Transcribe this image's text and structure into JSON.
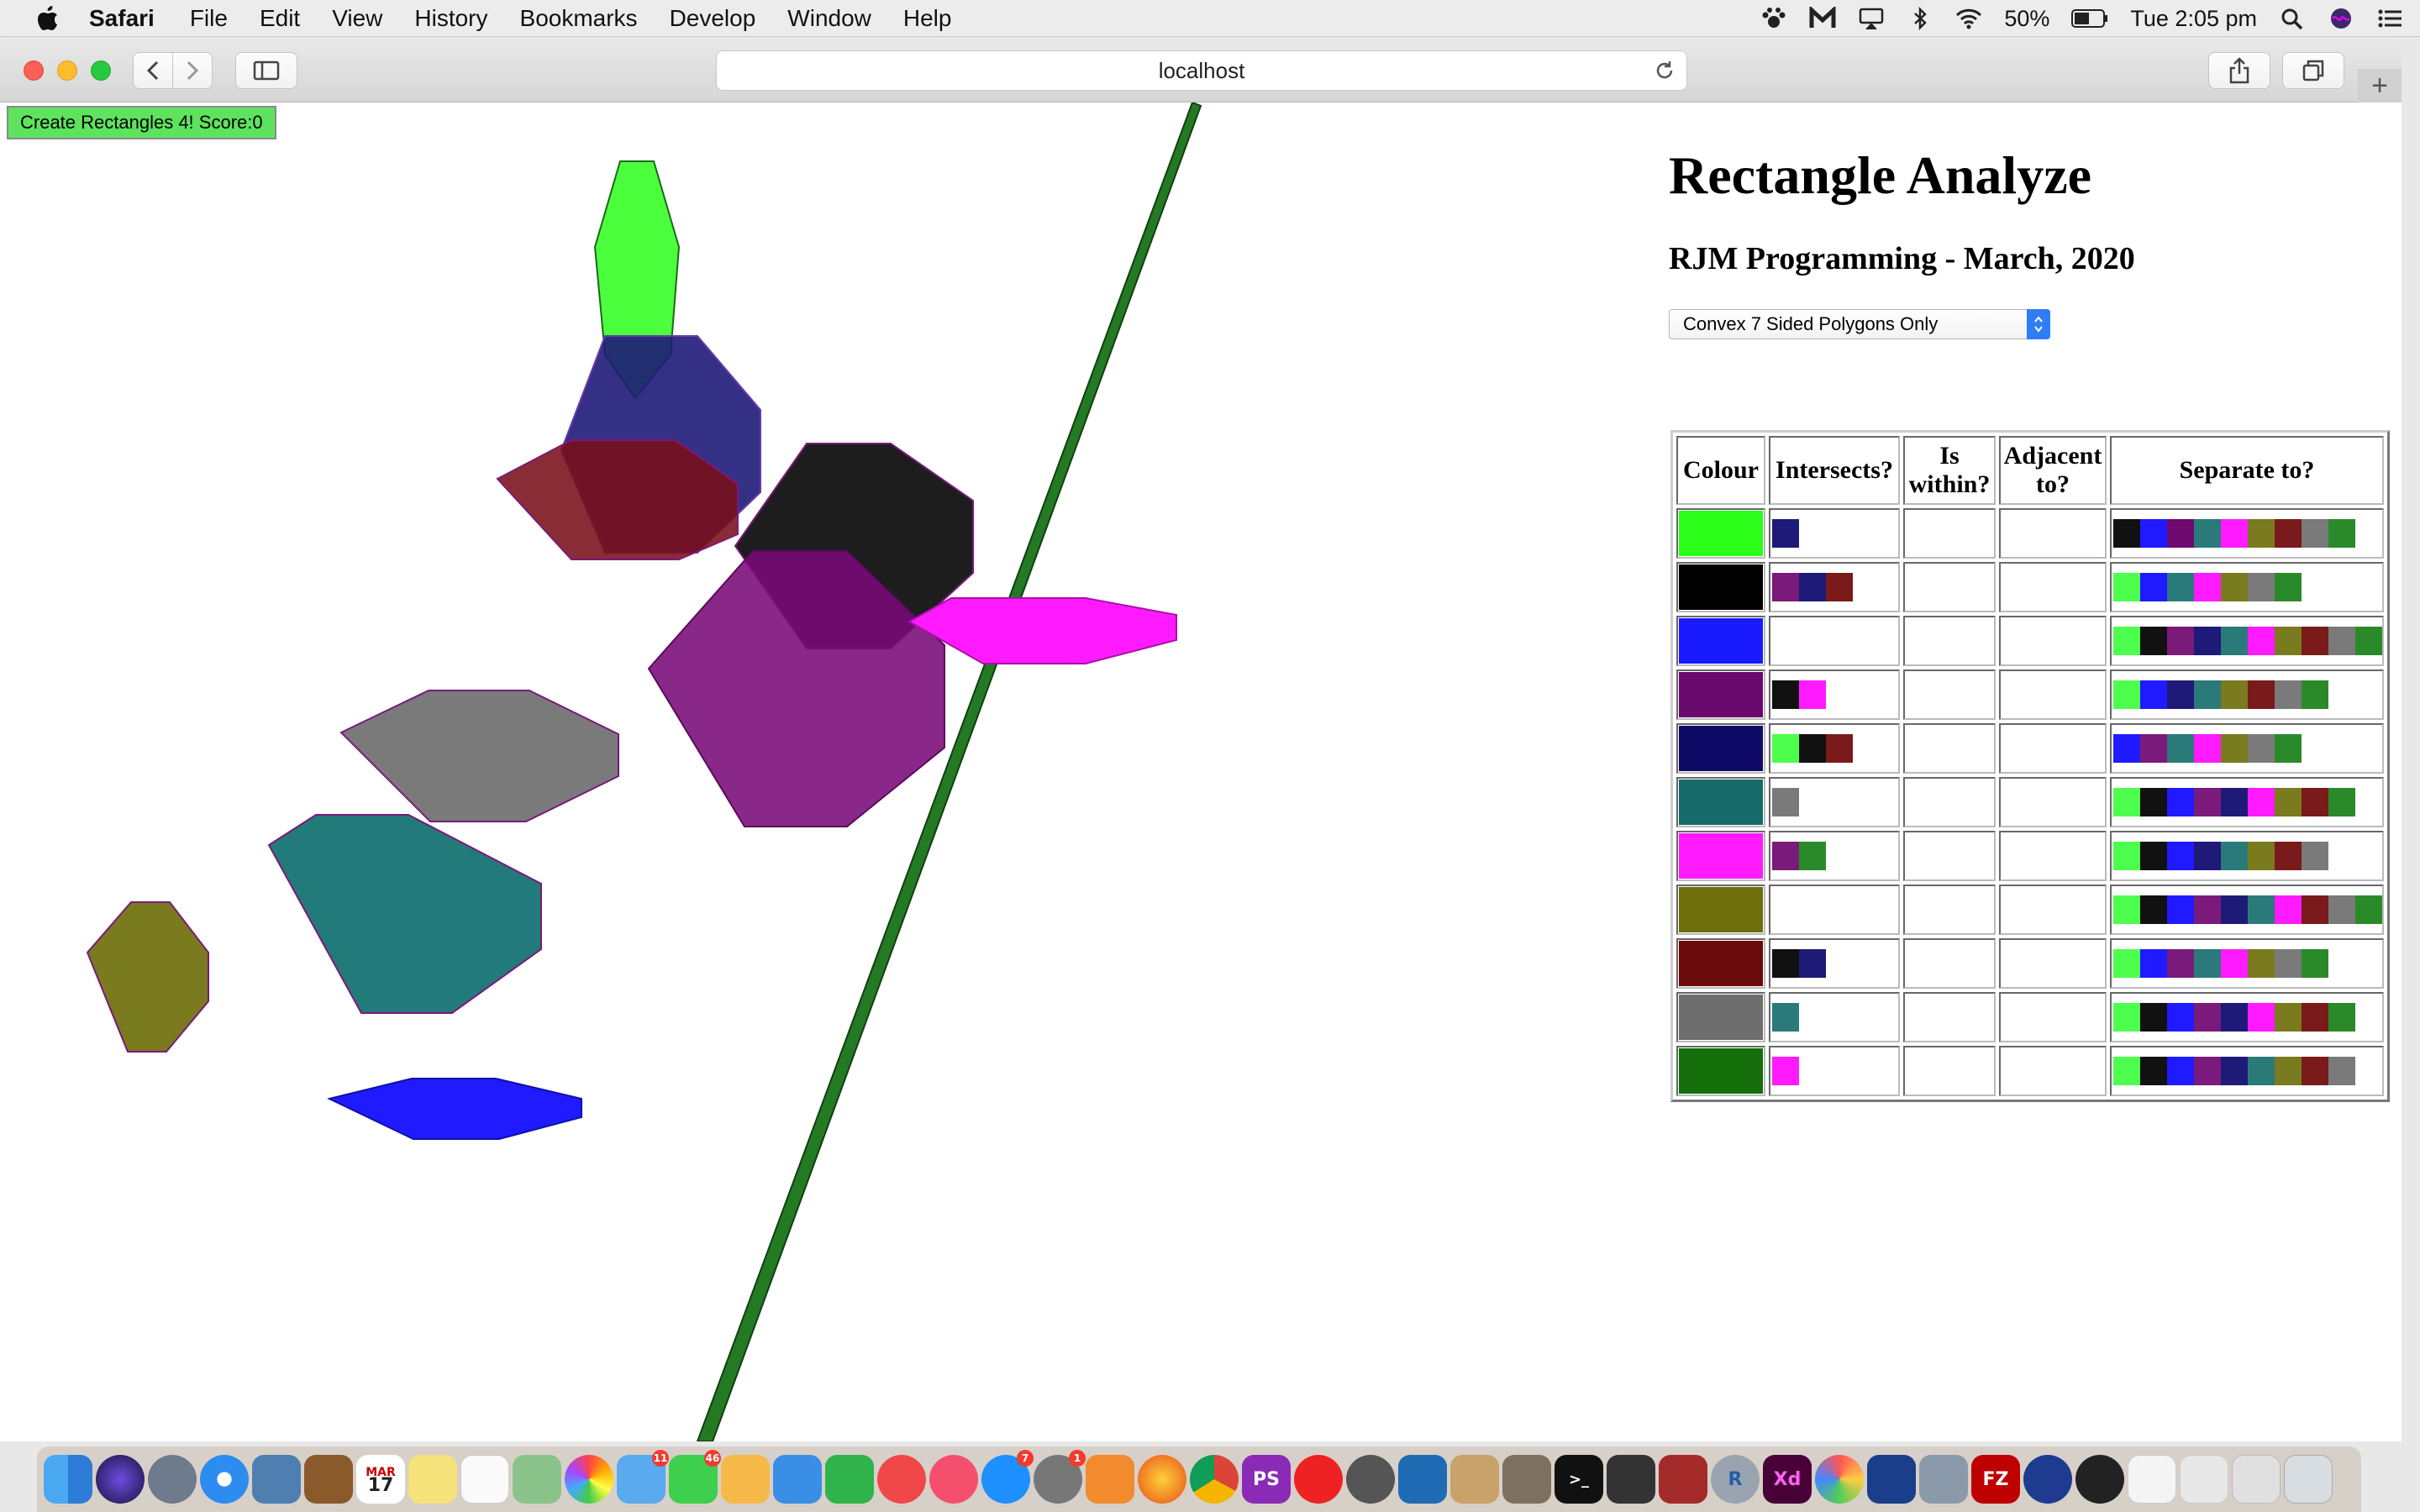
{
  "menubar": {
    "app": "Safari",
    "items": [
      "File",
      "Edit",
      "View",
      "History",
      "Bookmarks",
      "Develop",
      "Window",
      "Help"
    ],
    "battery": "50%",
    "clock": "Tue 2:05 pm"
  },
  "browser": {
    "url": "localhost"
  },
  "page": {
    "button_label": "Create Rectangles 4! Score:0",
    "title": "Rectangle Analyze",
    "subtitle": "RJM Programming - March, 2020",
    "select_value": "Convex 7 Sided Polygons Only",
    "table": {
      "headers": [
        "Colour",
        "Intersects?",
        "Is within?",
        "Adjacent to?",
        "Separate to?"
      ],
      "rows": [
        {
          "colour": "#2bff1a",
          "intersects": [
            "#1e1a78"
          ],
          "separate": [
            "#111111",
            "#1f1aff",
            "#6e0a72",
            "#2a7a7a",
            "#ff1aff",
            "#7a7a1e",
            "#7a1a1a",
            "#7a7a7a",
            "#2a8a2a"
          ]
        },
        {
          "colour": "#000000",
          "intersects": [
            "#7a1a7a",
            "#1e1a78",
            "#7a1a1a"
          ],
          "separate": [
            "#4dff4d",
            "#1f1aff",
            "#2a7a7a",
            "#ff1aff",
            "#7a7a1e",
            "#7a7a7a",
            "#2a8a2a"
          ]
        },
        {
          "colour": "#1a1aff",
          "intersects": [],
          "separate": [
            "#4dff4d",
            "#111111",
            "#7a1a7a",
            "#1e1a78",
            "#2a7a7a",
            "#ff1aff",
            "#7a7a1e",
            "#7a1a1a",
            "#7a7a7a",
            "#2a8a2a"
          ]
        },
        {
          "colour": "#6a0a6e",
          "intersects": [
            "#111111",
            "#ff1aff"
          ],
          "separate": [
            "#4dff4d",
            "#1f1aff",
            "#1e1a78",
            "#2a7a7a",
            "#7a7a1e",
            "#7a1a1a",
            "#7a7a7a",
            "#2a8a2a"
          ]
        },
        {
          "colour": "#0e0a66",
          "intersects": [
            "#4dff4d",
            "#111111",
            "#7a1a1a"
          ],
          "separate": [
            "#1f1aff",
            "#7a1a7a",
            "#2a7a7a",
            "#ff1aff",
            "#7a7a1e",
            "#7a7a7a",
            "#2a8a2a"
          ]
        },
        {
          "colour": "#166a6a",
          "intersects": [
            "#7a7a7a"
          ],
          "separate": [
            "#4dff4d",
            "#111111",
            "#1f1aff",
            "#7a1a7a",
            "#1e1a78",
            "#ff1aff",
            "#7a7a1e",
            "#7a1a1a",
            "#2a8a2a"
          ]
        },
        {
          "colour": "#ff1aff",
          "intersects": [
            "#7a1a7a",
            "#2a8a2a"
          ],
          "separate": [
            "#4dff4d",
            "#111111",
            "#1f1aff",
            "#1e1a78",
            "#2a7a7a",
            "#7a7a1e",
            "#7a1a1a",
            "#7a7a7a"
          ]
        },
        {
          "colour": "#6e6e0a",
          "intersects": [],
          "separate": [
            "#4dff4d",
            "#111111",
            "#1f1aff",
            "#7a1a7a",
            "#1e1a78",
            "#2a7a7a",
            "#ff1aff",
            "#7a1a1a",
            "#7a7a7a",
            "#2a8a2a"
          ]
        },
        {
          "colour": "#6a0a0a",
          "intersects": [
            "#111111",
            "#1e1a78"
          ],
          "separate": [
            "#4dff4d",
            "#1f1aff",
            "#7a1a7a",
            "#2a7a7a",
            "#ff1aff",
            "#7a7a1e",
            "#7a7a7a",
            "#2a8a2a"
          ]
        },
        {
          "colour": "#6e6e6e",
          "intersects": [
            "#2a7a7a"
          ],
          "separate": [
            "#4dff4d",
            "#111111",
            "#1f1aff",
            "#7a1a7a",
            "#1e1a78",
            "#ff1aff",
            "#7a7a1e",
            "#7a1a1a",
            "#2a8a2a"
          ]
        },
        {
          "colour": "#146e0a",
          "intersects": [
            "#ff1aff"
          ],
          "separate": [
            "#4dff4d",
            "#111111",
            "#1f1aff",
            "#7a1a7a",
            "#1e1a78",
            "#2a7a7a",
            "#7a7a1e",
            "#7a1a1a",
            "#7a7a7a"
          ]
        }
      ]
    }
  },
  "dock": {
    "badges": {
      "mail": "11",
      "messages": "46",
      "appstore": "7",
      "prefs": "1"
    },
    "labels": {
      "photoshop": "PS",
      "xd": "Xd",
      "filezilla": "FZ",
      "r": "R",
      "terminal": ">_",
      "calendar_month": "MAR",
      "calendar_day": "17"
    }
  }
}
